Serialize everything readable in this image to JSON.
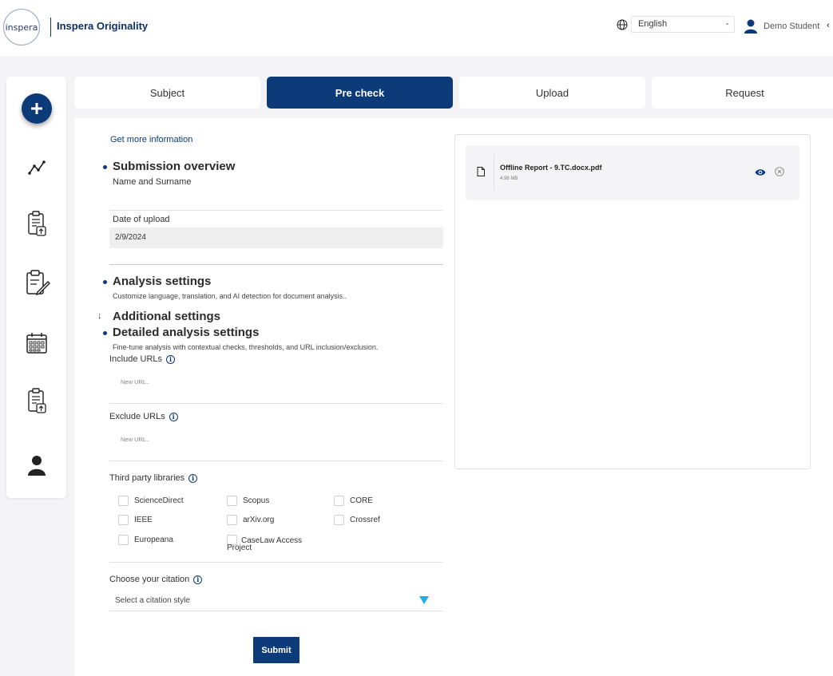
{
  "header": {
    "logo_text": "inspera",
    "app_title": "Inspera Originality",
    "language": "English",
    "user_name": "Demo Student"
  },
  "steps": [
    {
      "label": "Subject",
      "active": false
    },
    {
      "label": "Pre check",
      "active": true
    },
    {
      "label": "Upload",
      "active": false
    },
    {
      "label": "Request",
      "active": false
    }
  ],
  "sidebar": {
    "items": [
      "add-icon",
      "analytics-icon",
      "document-upload-icon",
      "clipboard-edit-icon",
      "calendar-icon",
      "document-upload-icon",
      "user-icon"
    ]
  },
  "form": {
    "more_info_link": "Get more information",
    "submission": {
      "title": "Submission overview",
      "name": "Name and Surname",
      "date_label": "Date of upload",
      "date_value": "2/9/2024"
    },
    "analysis": {
      "title": "Analysis settings",
      "description": "Customize language, translation, and AI detection for document analysis.."
    },
    "additional_title": "Additional settings",
    "detailed": {
      "title": "Detailed analysis settings",
      "description": "Fine-tune analysis with contextual checks, thresholds, and URL inclusion/exclusion."
    },
    "include_urls": {
      "label": "Include URLs",
      "placeholder": "New URL.."
    },
    "exclude_urls": {
      "label": "Exclude URLs",
      "placeholder": "New URL.."
    },
    "third_party": {
      "label": "Third party libraries",
      "libraries": [
        "ScienceDirect",
        "Scopus",
        "CORE",
        "IEEE",
        "arXiv.org",
        "Crossref",
        "Europeana",
        "CaseLaw Access Project"
      ]
    },
    "citation": {
      "label": "Choose your citation",
      "placeholder": "Select a citation style"
    },
    "submit_label": "Submit"
  },
  "file": {
    "name": "Offline Report - 9.TC.docx.pdf",
    "size": "4.96 MB"
  },
  "colors": {
    "primary": "#0d3a78",
    "accent_arrow": "#1faee6",
    "background": "#f4f4f6"
  }
}
